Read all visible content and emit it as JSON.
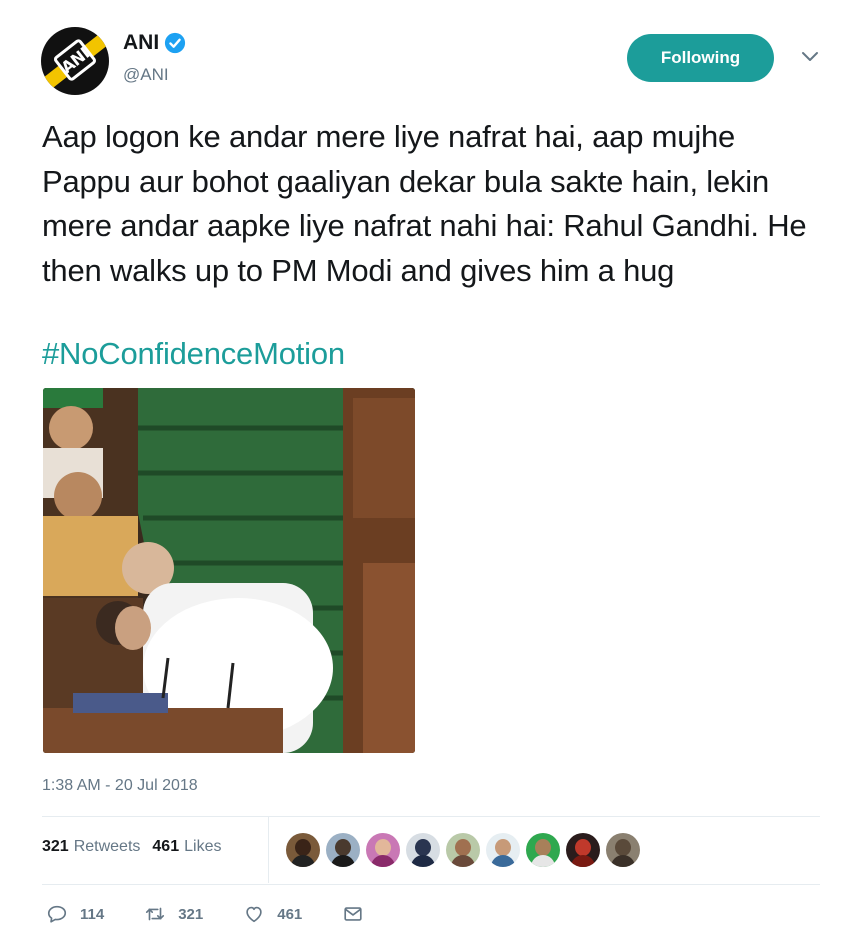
{
  "account": {
    "name": "ANI",
    "handle": "@ANI",
    "logo_text": "ANI",
    "verified": true
  },
  "follow_button": {
    "label": "Following"
  },
  "tweet": {
    "text": "Aap logon ke andar mere liye nafrat hai, aap mujhe Pappu aur bohot gaaliyan dekar bula sakte hain, lekin mere andar aapke liye nafrat nahi hai: Rahul Gandhi. He then walks up to PM Modi and gives him a hug",
    "hashtag": "#NoConfidenceMotion",
    "timestamp": "1:38 AM - 20 Jul 2018"
  },
  "stats": {
    "retweets_count": "321",
    "retweets_label": "Retweets",
    "likes_count": "461",
    "likes_label": "Likes"
  },
  "actions": {
    "reply_count": "114",
    "retweet_count": "321",
    "like_count": "461"
  },
  "icons": {
    "verified": "verified-badge-icon",
    "chevron": "chevron-down-icon",
    "reply": "reply-icon",
    "retweet": "retweet-icon",
    "like": "heart-icon",
    "dm": "envelope-icon"
  },
  "colors": {
    "accent": "#1c9d9a",
    "verified": "#1da1f2",
    "muted": "#657786",
    "text": "#14171a"
  }
}
